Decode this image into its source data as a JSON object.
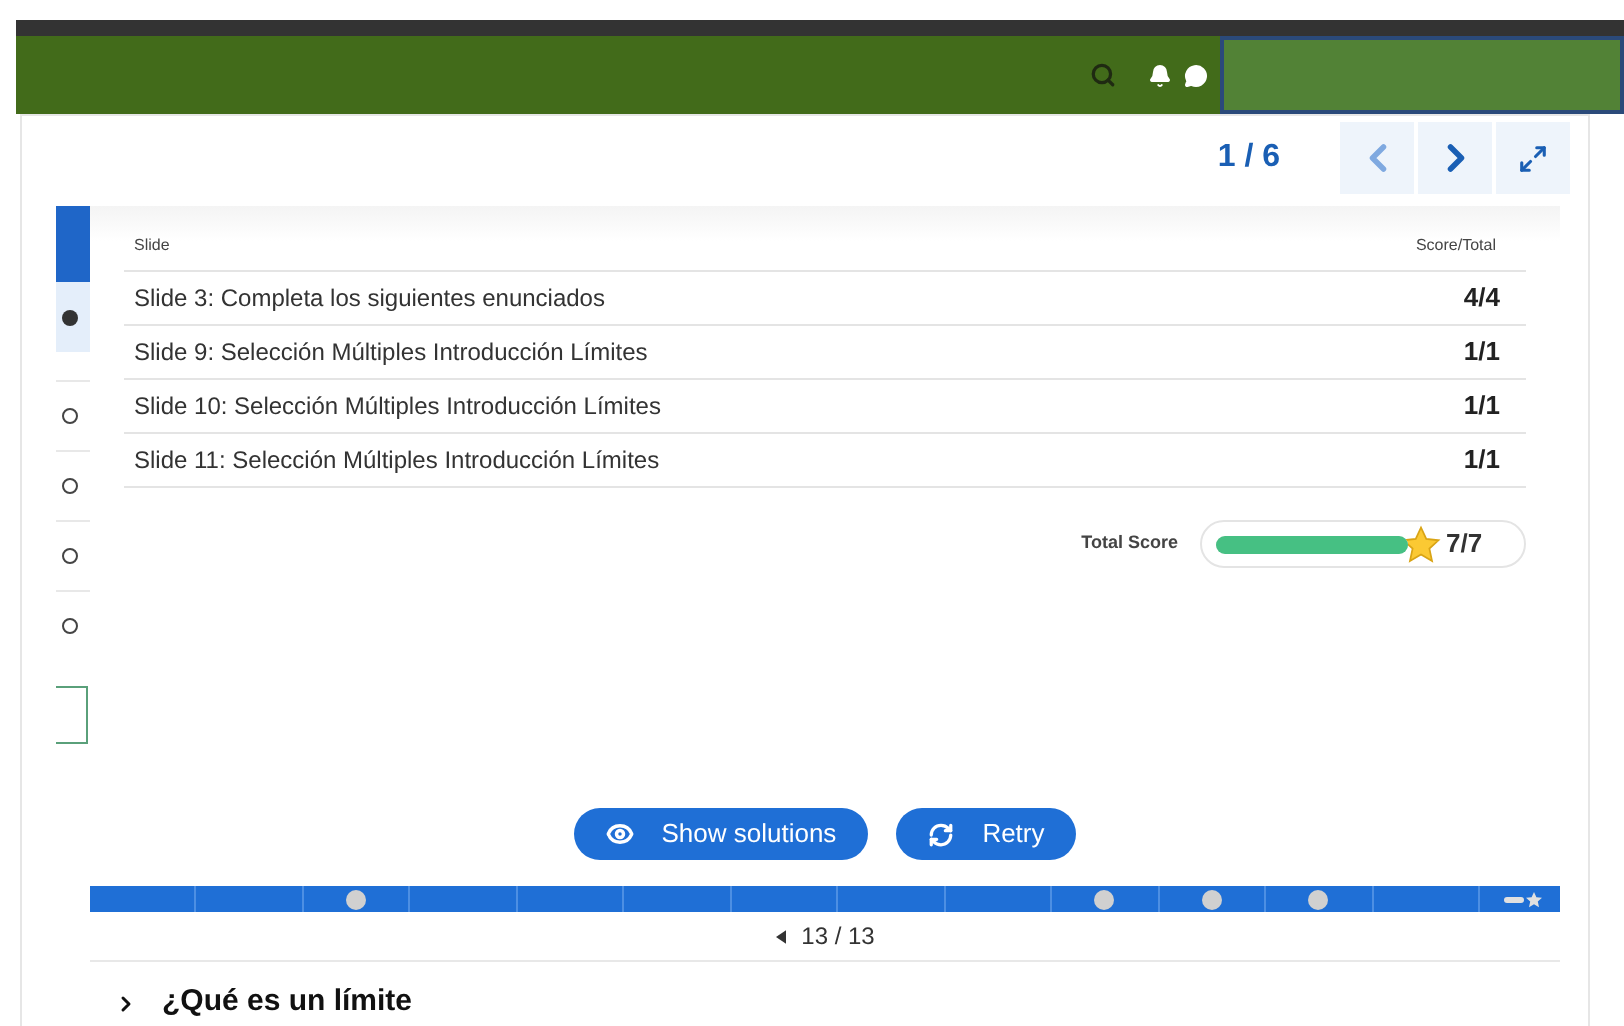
{
  "pager": {
    "text": "1 / 6"
  },
  "sidebar": {
    "items": [
      {
        "selected": true
      },
      {
        "selected": false
      },
      {
        "selected": false
      },
      {
        "selected": false
      },
      {
        "selected": false
      }
    ]
  },
  "table": {
    "columns": [
      "Slide",
      "Score/Total"
    ],
    "rows": [
      {
        "slide": "Slide 3: Completa los siguientes enunciados",
        "score": "4/4"
      },
      {
        "slide": "Slide 9: Selección Múltiples Introducción Límites",
        "score": "1/1"
      },
      {
        "slide": "Slide 10: Selección Múltiples Introducción Límites",
        "score": "1/1"
      },
      {
        "slide": "Slide 11: Selección Múltiples Introducción Límites",
        "score": "1/1"
      }
    ]
  },
  "total_score": {
    "label": "Total Score",
    "level": 1,
    "reading": "7/7"
  },
  "buttons": [
    {
      "kind": "solutions",
      "label": "Show solutions"
    },
    {
      "kind": "retry",
      "label": "Retry"
    }
  ],
  "progress": {
    "segments": [
      {
        "answered": false
      },
      {
        "answered": false
      },
      {
        "answered": true
      },
      {
        "answered": false
      },
      {
        "answered": false
      },
      {
        "answered": false
      },
      {
        "answered": false
      },
      {
        "answered": false
      },
      {
        "answered": false
      },
      {
        "answered": true
      },
      {
        "answered": true
      },
      {
        "answered": true
      },
      {
        "answered": false
      }
    ]
  },
  "slide_nav": {
    "text": "13 / 13"
  },
  "section": {
    "title": "¿Qué es un límite"
  }
}
